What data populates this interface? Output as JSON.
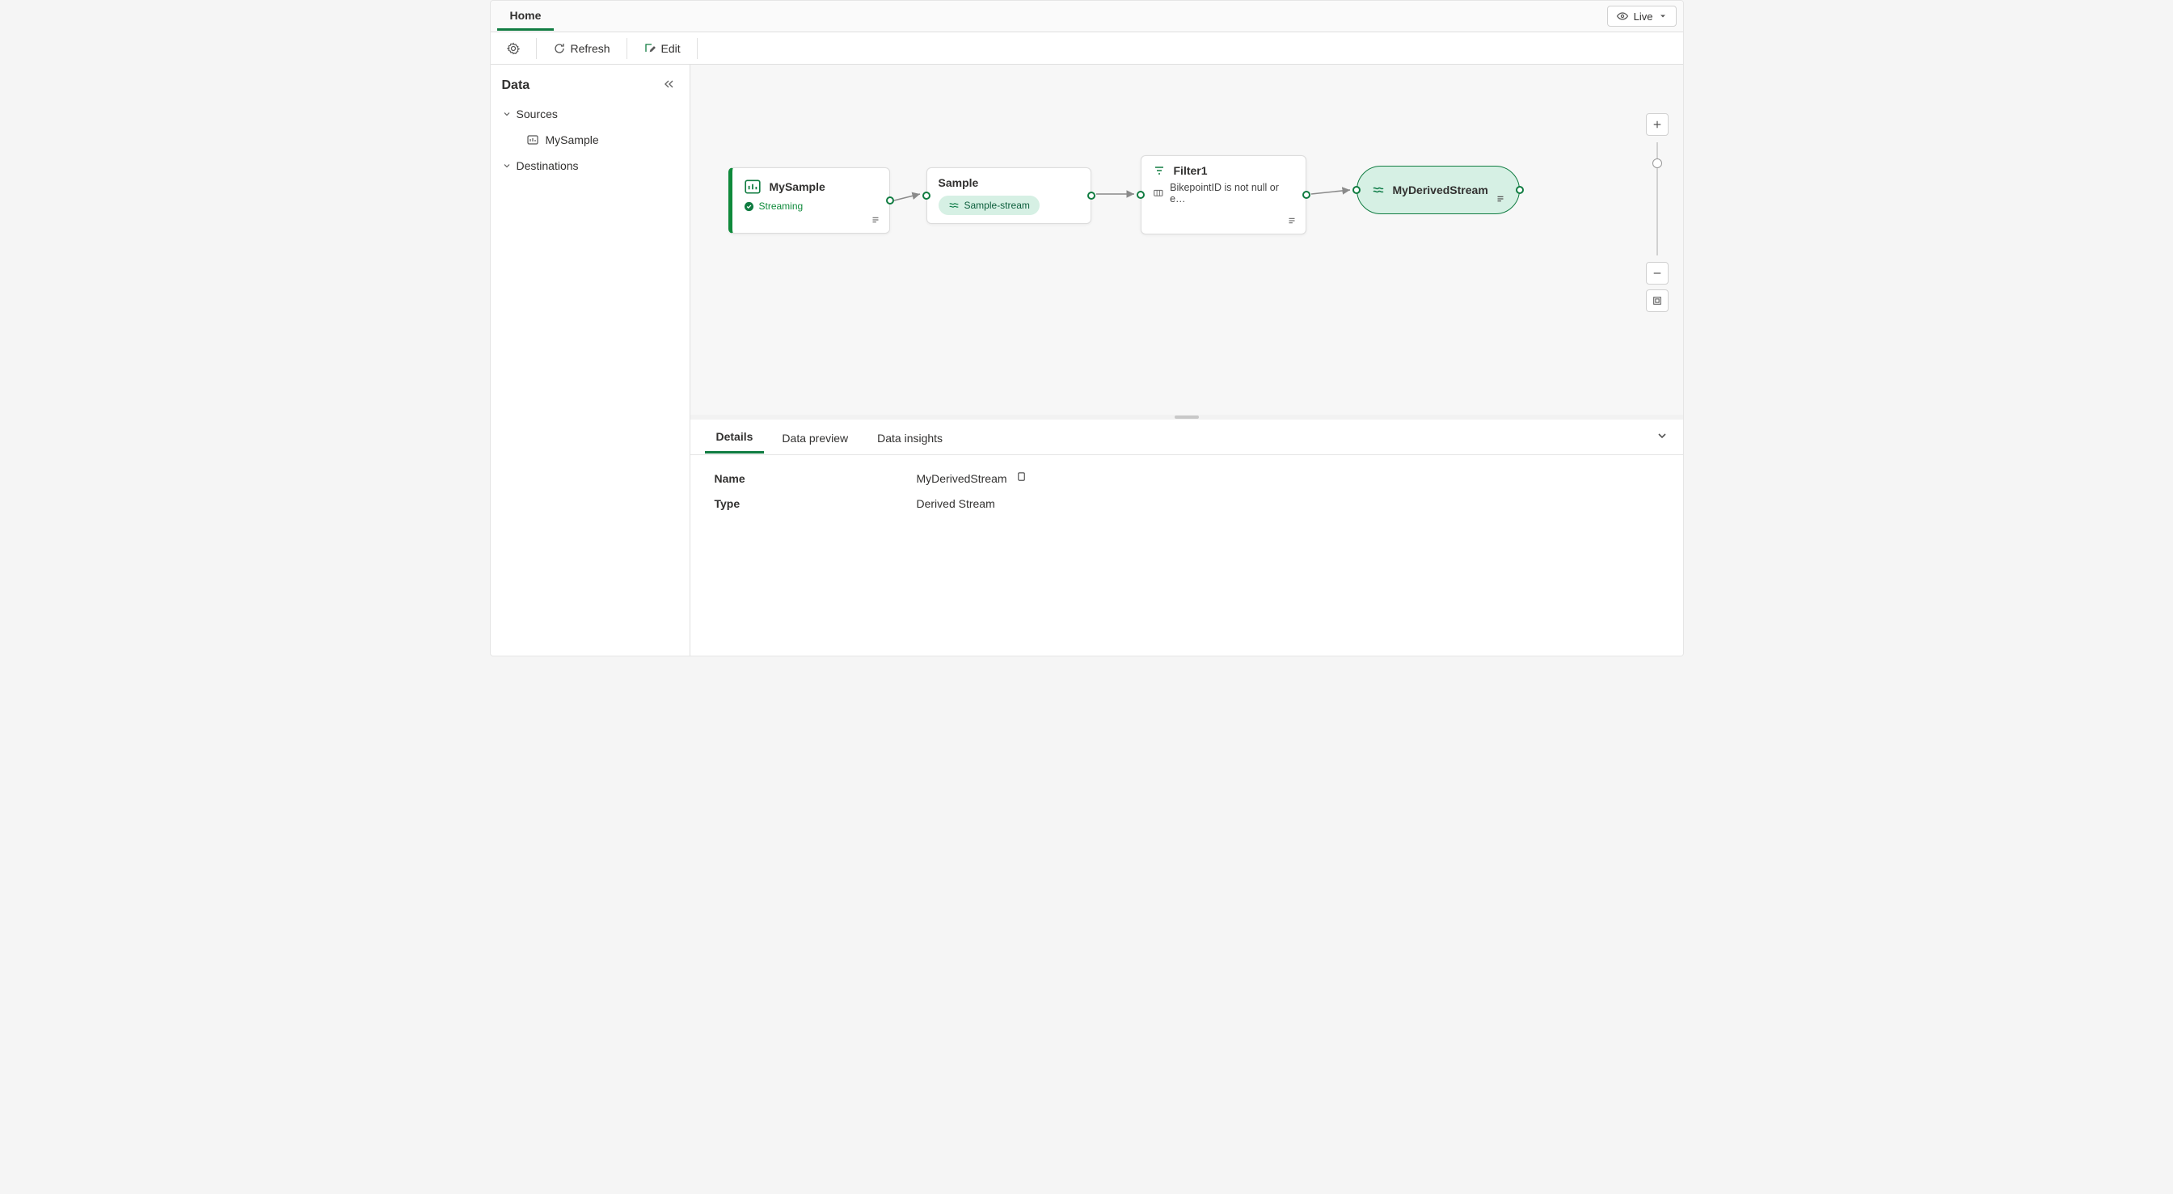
{
  "ribbon": {
    "tabs": [
      "Home"
    ],
    "active": 0,
    "live_label": "Live"
  },
  "toolbar": {
    "refresh": "Refresh",
    "edit": "Edit"
  },
  "sidebar": {
    "title": "Data",
    "sections": {
      "sources": {
        "label": "Sources",
        "items": [
          "MySample"
        ]
      },
      "destinations": {
        "label": "Destinations"
      }
    }
  },
  "canvas": {
    "nodes": {
      "source": {
        "title": "MySample",
        "status": "Streaming"
      },
      "sample": {
        "title": "Sample",
        "pill": "Sample-stream"
      },
      "filter": {
        "title": "Filter1",
        "expr": "BikepointID is not null or e…"
      },
      "derived": {
        "title": "MyDerivedStream"
      }
    }
  },
  "panel": {
    "tabs": [
      "Details",
      "Data preview",
      "Data insights"
    ],
    "active": 0,
    "details": {
      "name_label": "Name",
      "name_value": "MyDerivedStream",
      "type_label": "Type",
      "type_value": "Derived Stream"
    }
  }
}
